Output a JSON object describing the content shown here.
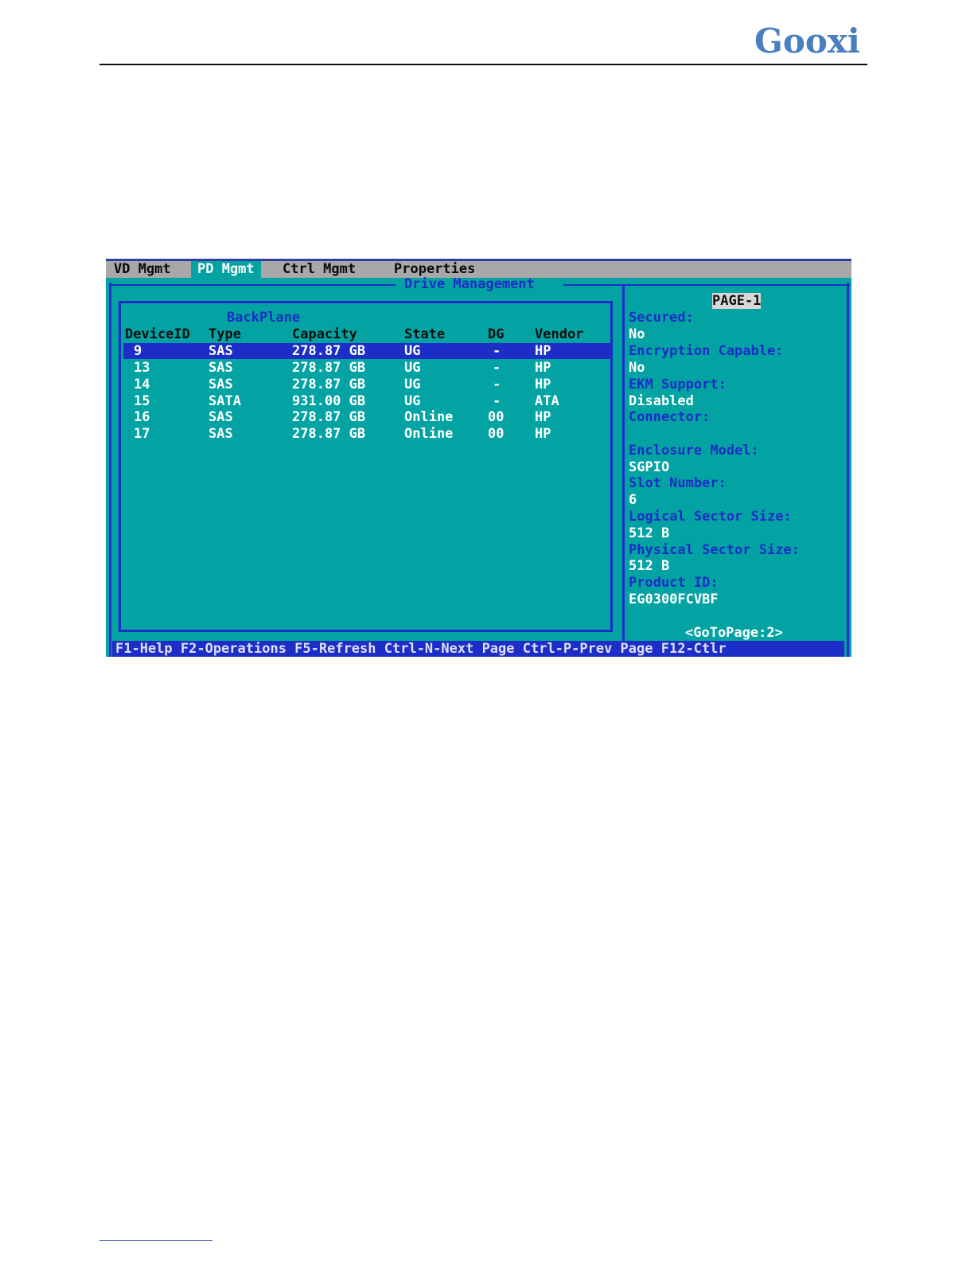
{
  "document": {
    "logo_text": "Gooxi"
  },
  "bios": {
    "menu": [
      {
        "label": "VD Mgmt",
        "active": false
      },
      {
        "label": "PD Mgmt",
        "active": true
      },
      {
        "label": "Ctrl Mgmt",
        "active": false
      },
      {
        "label": "Properties",
        "active": false
      }
    ],
    "panel_title": "Drive Management",
    "section_title": "BackPlane",
    "columns": [
      "DeviceID",
      "Type",
      "Capacity",
      "State",
      "DG",
      "Vendor"
    ],
    "rows": [
      {
        "device_id": "9",
        "type": "SAS",
        "capacity": "278.87 GB",
        "state": "UG",
        "dg": "-",
        "vendor": "HP",
        "selected": true
      },
      {
        "device_id": "13",
        "type": "SAS",
        "capacity": "278.87 GB",
        "state": "UG",
        "dg": "-",
        "vendor": "HP",
        "selected": false
      },
      {
        "device_id": "14",
        "type": "SAS",
        "capacity": "278.87 GB",
        "state": "UG",
        "dg": "-",
        "vendor": "HP",
        "selected": false
      },
      {
        "device_id": "15",
        "type": "SATA",
        "capacity": "931.00 GB",
        "state": "UG",
        "dg": "-",
        "vendor": "ATA",
        "selected": false
      },
      {
        "device_id": "16",
        "type": "SAS",
        "capacity": "278.87 GB",
        "state": "Online",
        "dg": "00",
        "vendor": "HP",
        "selected": false
      },
      {
        "device_id": "17",
        "type": "SAS",
        "capacity": "278.87 GB",
        "state": "Online",
        "dg": "00",
        "vendor": "HP",
        "selected": false
      }
    ],
    "properties": {
      "page_label": "PAGE-1",
      "fields": [
        {
          "label": "Secured:",
          "value": "No"
        },
        {
          "label": "Encryption Capable:",
          "value": "No"
        },
        {
          "label": "EKM Support:",
          "value": "Disabled"
        },
        {
          "label": "Connector:",
          "value": ""
        },
        {
          "label": "Enclosure Model:",
          "value": "SGPIO"
        },
        {
          "label": "Slot Number:",
          "value": "6"
        },
        {
          "label": "Logical Sector Size:",
          "value": "512 B"
        },
        {
          "label": "Physical Sector Size:",
          "value": "512 B"
        },
        {
          "label": "Product ID:",
          "value": "EG0300FCVBF"
        }
      ],
      "goto_page": "<GoToPage:2>"
    },
    "status_bar": "F1-Help F2-Operations F5-Refresh Ctrl-N-Next Page Ctrl-P-Prev Page F12-Ctlr",
    "colors": {
      "background": "#04a3a3",
      "accent_blue": "#1c2ec6",
      "menubar": "#a8a8a8",
      "text_white": "#ffffff"
    }
  }
}
